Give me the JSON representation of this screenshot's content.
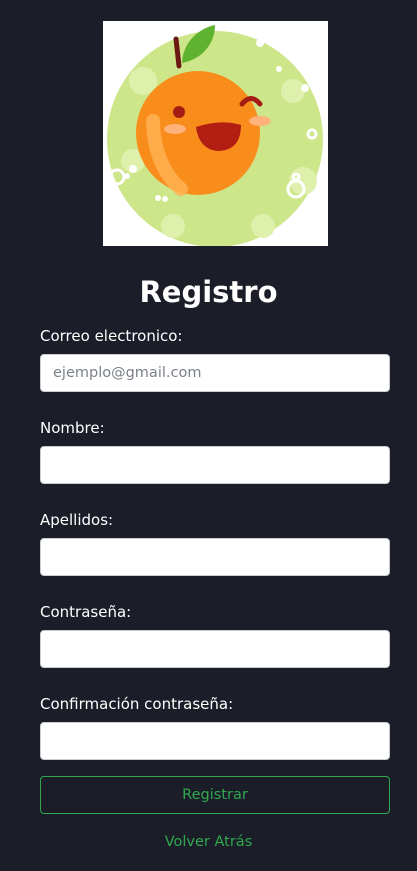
{
  "logo": {
    "icon": "orange-mascot-logo"
  },
  "title": "Registro",
  "fields": {
    "email": {
      "label": "Correo electronico:",
      "placeholder": "ejemplo@gmail.com",
      "value": ""
    },
    "name": {
      "label": "Nombre:",
      "placeholder": "",
      "value": ""
    },
    "surname": {
      "label": "Apellidos:",
      "placeholder": "",
      "value": ""
    },
    "password": {
      "label": "Contraseña:",
      "placeholder": "",
      "value": ""
    },
    "password_confirm": {
      "label": "Confirmación contraseña:",
      "placeholder": "",
      "value": ""
    }
  },
  "submit_label": "Registrar",
  "back_link": "Volver Atrás",
  "colors": {
    "background": "#1b1e28",
    "accent_green": "#2fa84f",
    "orange": "#f98d1c"
  }
}
